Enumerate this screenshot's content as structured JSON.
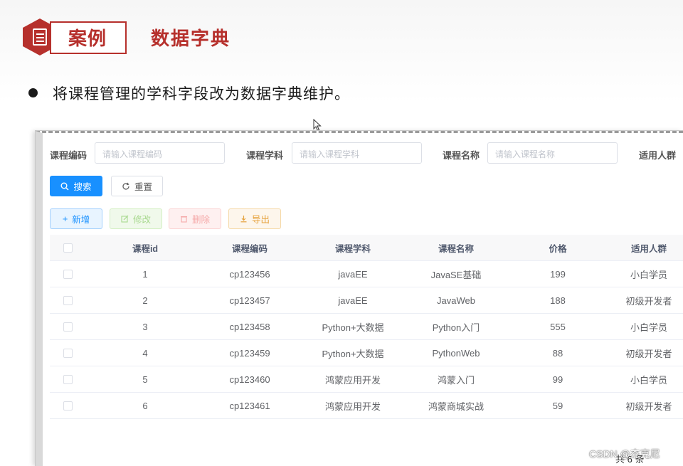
{
  "slide": {
    "tag": "案例",
    "title": "数据字典",
    "bullet": "将课程管理的学科字段改为数据字典维护。"
  },
  "search_form": {
    "fields": [
      {
        "label": "课程编码",
        "placeholder": "请输入课程编码"
      },
      {
        "label": "课程学科",
        "placeholder": "请输入课程学科"
      },
      {
        "label": "课程名称",
        "placeholder": "请输入课程名称"
      },
      {
        "label": "适用人群"
      }
    ],
    "search_label": "搜索",
    "reset_label": "重置"
  },
  "toolbar": {
    "add_label": "新增",
    "edit_label": "修改",
    "delete_label": "删除",
    "export_label": "导出"
  },
  "table": {
    "columns": [
      "课程id",
      "课程编码",
      "课程学科",
      "课程名称",
      "价格",
      "适用人群"
    ],
    "rows": [
      [
        "1",
        "cp123456",
        "javaEE",
        "JavaSE基础",
        "199",
        "小白学员"
      ],
      [
        "2",
        "cp123457",
        "javaEE",
        "JavaWeb",
        "188",
        "初级开发者"
      ],
      [
        "3",
        "cp123458",
        "Python+大数据",
        "Python入门",
        "555",
        "小白学员"
      ],
      [
        "4",
        "cp123459",
        "Python+大数据",
        "PythonWeb",
        "88",
        "初级开发者"
      ],
      [
        "5",
        "cp123460",
        "鸿蒙应用开发",
        "鸿蒙入门",
        "99",
        "小白学员"
      ],
      [
        "6",
        "cp123461",
        "鸿蒙应用开发",
        "鸿蒙商城实战",
        "59",
        "初级开发者"
      ]
    ]
  },
  "pagination": {
    "total_text": "共 6 条"
  },
  "watermark": "CSDN @杰克尼",
  "colors": {
    "brand_red": "#b6302c",
    "primary": "#1890ff"
  }
}
